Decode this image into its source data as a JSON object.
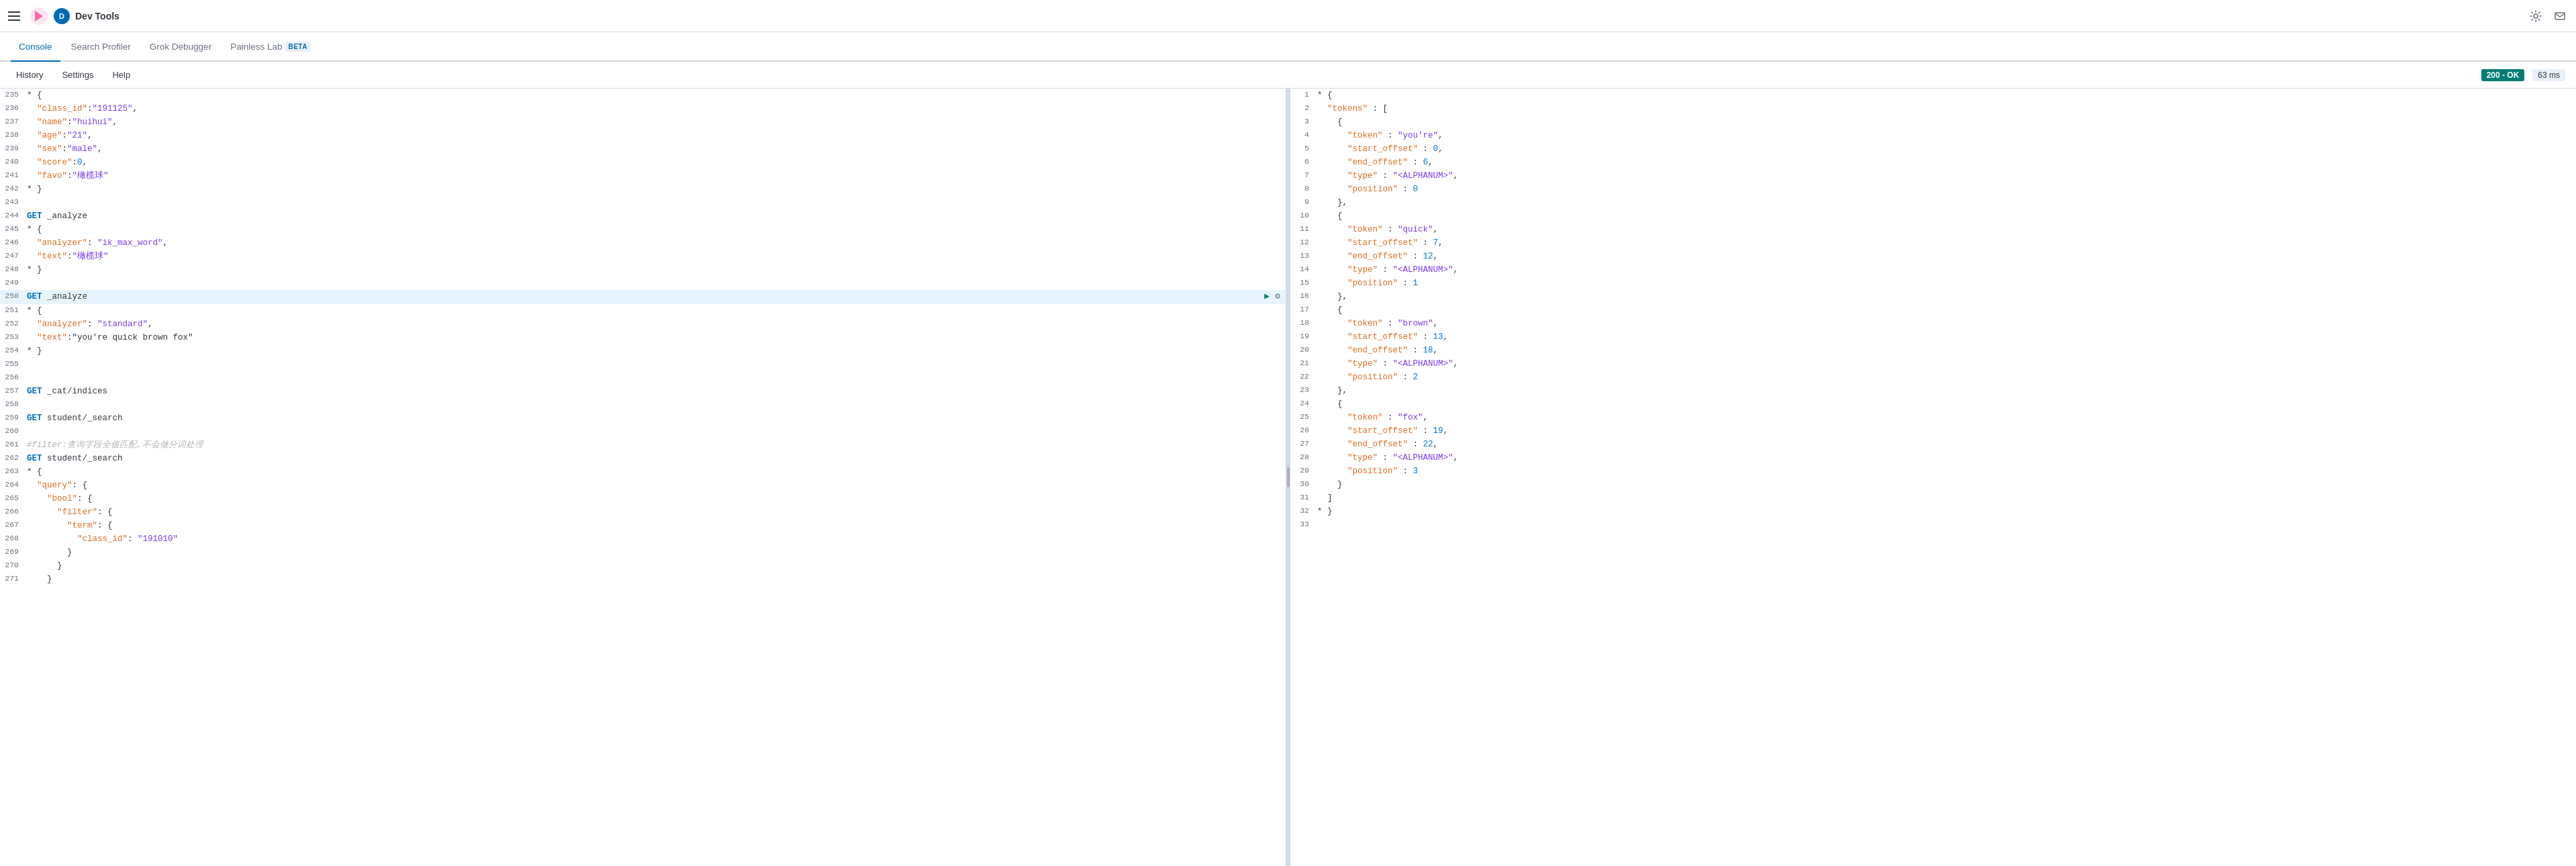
{
  "topbar": {
    "app_title": "Dev Tools",
    "app_badge": "D"
  },
  "nav": {
    "tabs": [
      {
        "id": "console",
        "label": "Console",
        "active": true
      },
      {
        "id": "search-profiler",
        "label": "Search Profiler",
        "active": false
      },
      {
        "id": "grok-debugger",
        "label": "Grok Debugger",
        "active": false
      },
      {
        "id": "painless-lab",
        "label": "Painless Lab",
        "active": false,
        "beta": true
      }
    ]
  },
  "toolbar": {
    "history_label": "History",
    "settings_label": "Settings",
    "help_label": "Help",
    "status": "200 - OK",
    "time": "63 ms"
  },
  "left_panel": {
    "lines": [
      {
        "num": "235",
        "tokens": [
          {
            "text": "* {",
            "cls": "punct"
          }
        ]
      },
      {
        "num": "236",
        "tokens": [
          {
            "text": "  \"class_id\":\"191125\",",
            "cls": ""
          }
        ]
      },
      {
        "num": "237",
        "tokens": [
          {
            "text": "  \"name\":\"huihui\",",
            "cls": ""
          }
        ]
      },
      {
        "num": "238",
        "tokens": [
          {
            "text": "  \"age\":\"21\",",
            "cls": ""
          }
        ]
      },
      {
        "num": "239",
        "tokens": [
          {
            "text": "  \"sex\":\"male\",",
            "cls": ""
          }
        ]
      },
      {
        "num": "240",
        "tokens": [
          {
            "text": "  \"score\":0,",
            "cls": ""
          }
        ]
      },
      {
        "num": "241",
        "tokens": [
          {
            "text": "  \"favo\":\"橄榄球\"",
            "cls": ""
          }
        ]
      },
      {
        "num": "242",
        "tokens": [
          {
            "text": "* }",
            "cls": "punct"
          }
        ]
      },
      {
        "num": "243",
        "tokens": [
          {
            "text": "",
            "cls": ""
          }
        ]
      },
      {
        "num": "244",
        "tokens": [
          {
            "text": "GET _analyze",
            "cls": "method-line"
          }
        ]
      },
      {
        "num": "245",
        "tokens": [
          {
            "text": "* {",
            "cls": "punct"
          }
        ]
      },
      {
        "num": "246",
        "tokens": [
          {
            "text": "  \"analyzer\": \"ik_max_word\",",
            "cls": ""
          }
        ]
      },
      {
        "num": "247",
        "tokens": [
          {
            "text": "  \"text\":\"橄榄球\"",
            "cls": ""
          }
        ]
      },
      {
        "num": "248",
        "tokens": [
          {
            "text": "* }",
            "cls": "punct"
          }
        ]
      },
      {
        "num": "249",
        "tokens": [
          {
            "text": "",
            "cls": ""
          }
        ]
      },
      {
        "num": "250",
        "tokens": [
          {
            "text": "GET _analyze",
            "cls": "method-line",
            "selected": true,
            "has_actions": true
          }
        ]
      },
      {
        "num": "251",
        "tokens": [
          {
            "text": "* {",
            "cls": "punct"
          }
        ]
      },
      {
        "num": "252",
        "tokens": [
          {
            "text": "  \"analyzer\": \"standard\",",
            "cls": ""
          }
        ]
      },
      {
        "num": "253",
        "tokens": [
          {
            "text": "  \"text\":\"you're quick brown fox\"",
            "cls": ""
          }
        ]
      },
      {
        "num": "254",
        "tokens": [
          {
            "text": "* }",
            "cls": "punct"
          }
        ]
      },
      {
        "num": "255",
        "tokens": [
          {
            "text": "",
            "cls": ""
          }
        ]
      },
      {
        "num": "256",
        "tokens": [
          {
            "text": "",
            "cls": ""
          }
        ]
      },
      {
        "num": "257",
        "tokens": [
          {
            "text": "GET _cat/indices",
            "cls": "method-line"
          }
        ]
      },
      {
        "num": "258",
        "tokens": [
          {
            "text": "",
            "cls": ""
          }
        ]
      },
      {
        "num": "259",
        "tokens": [
          {
            "text": "GET student/_search",
            "cls": "method-line"
          }
        ]
      },
      {
        "num": "260",
        "tokens": [
          {
            "text": "",
            "cls": ""
          }
        ]
      },
      {
        "num": "261",
        "tokens": [
          {
            "text": "#filter:查询字段全值匹配,不会做分词处理",
            "cls": "comment"
          }
        ]
      },
      {
        "num": "262",
        "tokens": [
          {
            "text": "GET student/_search",
            "cls": "method-line"
          }
        ]
      },
      {
        "num": "263",
        "tokens": [
          {
            "text": "* {",
            "cls": "punct"
          }
        ]
      },
      {
        "num": "264",
        "tokens": [
          {
            "text": "  \"query\": {",
            "cls": ""
          }
        ]
      },
      {
        "num": "265",
        "tokens": [
          {
            "text": "    \"bool\": {",
            "cls": ""
          }
        ]
      },
      {
        "num": "266",
        "tokens": [
          {
            "text": "      \"filter\": {",
            "cls": ""
          }
        ]
      },
      {
        "num": "267",
        "tokens": [
          {
            "text": "        \"term\": {",
            "cls": ""
          }
        ]
      },
      {
        "num": "268",
        "tokens": [
          {
            "text": "          \"class_id\": \"191010\"",
            "cls": ""
          }
        ]
      },
      {
        "num": "269",
        "tokens": [
          {
            "text": "        }",
            "cls": ""
          }
        ]
      },
      {
        "num": "270",
        "tokens": [
          {
            "text": "      }",
            "cls": ""
          }
        ]
      },
      {
        "num": "271",
        "tokens": [
          {
            "text": "    }",
            "cls": ""
          }
        ]
      }
    ]
  },
  "right_panel": {
    "lines": [
      {
        "num": "1",
        "tokens": [
          {
            "text": "* {",
            "cls": "punct"
          }
        ]
      },
      {
        "num": "2",
        "tokens": [
          {
            "text": "  \"tokens\" : [",
            "cls": ""
          }
        ]
      },
      {
        "num": "3",
        "tokens": [
          {
            "text": "    {",
            "cls": "punct"
          }
        ]
      },
      {
        "num": "4",
        "tokens": [
          {
            "text": "      \"token\" : \"you're\",",
            "cls": ""
          }
        ]
      },
      {
        "num": "5",
        "tokens": [
          {
            "text": "      \"start_offset\" : 0,",
            "cls": ""
          }
        ]
      },
      {
        "num": "6",
        "tokens": [
          {
            "text": "      \"end_offset\" : 6,",
            "cls": ""
          }
        ]
      },
      {
        "num": "7",
        "tokens": [
          {
            "text": "      \"type\" : \"<ALPHANUM>\",",
            "cls": ""
          }
        ]
      },
      {
        "num": "8",
        "tokens": [
          {
            "text": "      \"position\" : 0",
            "cls": ""
          }
        ]
      },
      {
        "num": "9",
        "tokens": [
          {
            "text": "    },",
            "cls": ""
          }
        ]
      },
      {
        "num": "10",
        "tokens": [
          {
            "text": "    {",
            "cls": "punct"
          }
        ]
      },
      {
        "num": "11",
        "tokens": [
          {
            "text": "      \"token\" : \"quick\",",
            "cls": ""
          }
        ]
      },
      {
        "num": "12",
        "tokens": [
          {
            "text": "      \"start_offset\" : 7,",
            "cls": ""
          }
        ]
      },
      {
        "num": "13",
        "tokens": [
          {
            "text": "      \"end_offset\" : 12,",
            "cls": ""
          }
        ]
      },
      {
        "num": "14",
        "tokens": [
          {
            "text": "      \"type\" : \"<ALPHANUM>\",",
            "cls": ""
          }
        ]
      },
      {
        "num": "15",
        "tokens": [
          {
            "text": "      \"position\" : 1",
            "cls": ""
          }
        ]
      },
      {
        "num": "16",
        "tokens": [
          {
            "text": "    },",
            "cls": ""
          }
        ]
      },
      {
        "num": "17",
        "tokens": [
          {
            "text": "    {",
            "cls": "punct"
          }
        ]
      },
      {
        "num": "18",
        "tokens": [
          {
            "text": "      \"token\" : \"brown\",",
            "cls": ""
          }
        ]
      },
      {
        "num": "19",
        "tokens": [
          {
            "text": "      \"start_offset\" : 13,",
            "cls": ""
          }
        ]
      },
      {
        "num": "20",
        "tokens": [
          {
            "text": "      \"end_offset\" : 18,",
            "cls": ""
          }
        ]
      },
      {
        "num": "21",
        "tokens": [
          {
            "text": "      \"type\" : \"<ALPHANUM>\",",
            "cls": ""
          }
        ]
      },
      {
        "num": "22",
        "tokens": [
          {
            "text": "      \"position\" : 2",
            "cls": ""
          }
        ]
      },
      {
        "num": "23",
        "tokens": [
          {
            "text": "    },",
            "cls": "punct",
            "highlighted": true
          }
        ]
      },
      {
        "num": "24",
        "tokens": [
          {
            "text": "    {",
            "cls": "punct"
          }
        ]
      },
      {
        "num": "25",
        "tokens": [
          {
            "text": "      \"token\" : \"fox\",",
            "cls": ""
          }
        ]
      },
      {
        "num": "26",
        "tokens": [
          {
            "text": "      \"start_offset\" : 19,",
            "cls": ""
          }
        ]
      },
      {
        "num": "27",
        "tokens": [
          {
            "text": "      \"end_offset\" : 22,",
            "cls": ""
          }
        ]
      },
      {
        "num": "28",
        "tokens": [
          {
            "text": "      \"type\" : \"<ALPHANUM>\",",
            "cls": ""
          }
        ]
      },
      {
        "num": "29",
        "tokens": [
          {
            "text": "      \"position\" : 3",
            "cls": ""
          }
        ]
      },
      {
        "num": "30",
        "tokens": [
          {
            "text": "    }",
            "cls": ""
          }
        ]
      },
      {
        "num": "31",
        "tokens": [
          {
            "text": "  ]",
            "cls": ""
          }
        ]
      },
      {
        "num": "32",
        "tokens": [
          {
            "text": "* }",
            "cls": "punct"
          }
        ]
      },
      {
        "num": "33",
        "tokens": [
          {
            "text": "",
            "cls": ""
          }
        ]
      }
    ]
  }
}
